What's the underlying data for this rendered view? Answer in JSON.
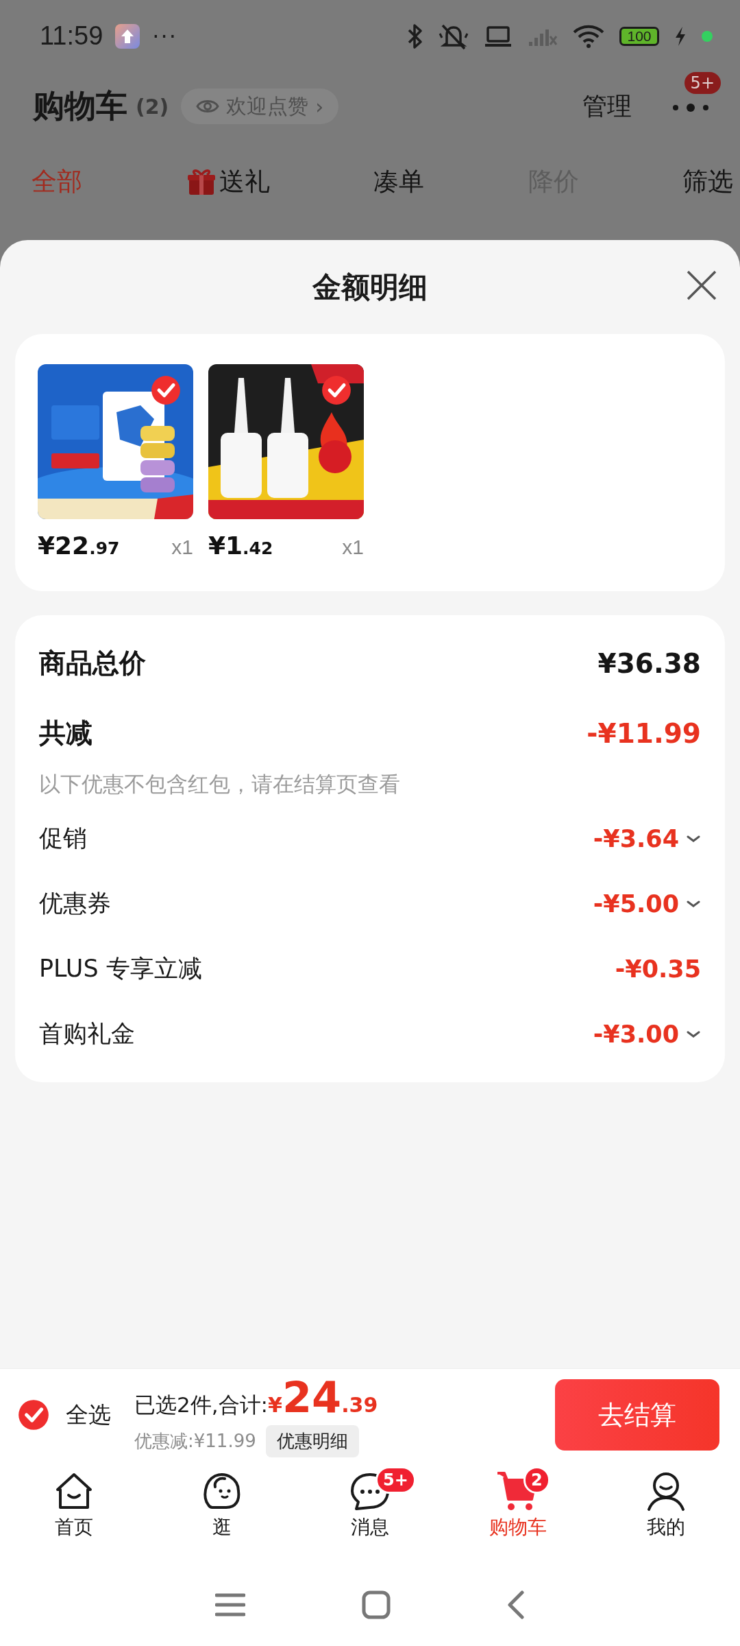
{
  "status_bar": {
    "time": "11:59",
    "more": "···",
    "battery": "100"
  },
  "header": {
    "title": "购物车",
    "count": "(2)",
    "like_pill": "欢迎点赞",
    "like_chevron": "›",
    "manage": "管理",
    "more_badge": "5+"
  },
  "tabs": [
    {
      "label": "全部",
      "selected": true,
      "disabled": false,
      "gift": false
    },
    {
      "label": "送礼",
      "selected": false,
      "disabled": false,
      "gift": true
    },
    {
      "label": "凑单",
      "selected": false,
      "disabled": false,
      "gift": false
    },
    {
      "label": "降价",
      "selected": false,
      "disabled": true,
      "gift": false
    },
    {
      "label": "筛选",
      "selected": false,
      "disabled": false,
      "gift": false
    }
  ],
  "sheet": {
    "title": "金额明细",
    "items": [
      {
        "kind": "picture",
        "selected": true,
        "price": "¥22",
        "price_cents": ".97",
        "quantity": "x1"
      },
      {
        "kind": "picture",
        "selected": true,
        "price": "¥1",
        "price_cents": ".42",
        "quantity": "x1"
      }
    ],
    "summary": {
      "total_label": "商品总价",
      "total_value": "¥36.38",
      "discount_label": "共减",
      "discount_value": "-¥11.99",
      "note": "以下优惠不包含红包，请在结算页查看",
      "rows": [
        {
          "label": "促销",
          "value": "-¥3.64",
          "expandable": true
        },
        {
          "label": "优惠券",
          "value": "-¥5.00",
          "expandable": true
        },
        {
          "label": "PLUS 专享立减",
          "value": "-¥0.35",
          "expandable": false
        },
        {
          "label": "首购礼金",
          "value": "-¥3.00",
          "expandable": true
        }
      ]
    }
  },
  "checkout_bar": {
    "select_all": {
      "label": "全选",
      "checked": true
    },
    "selected_text": "已选2件,合计:",
    "total_currency": "¥",
    "total_integer": "24",
    "total_fraction": ".39",
    "saving": "优惠减:¥11.99",
    "details_button": "优惠明细",
    "checkout_button": "去结算"
  },
  "bottom_nav": [
    {
      "kind": "home",
      "label": "首页",
      "selected": false
    },
    {
      "kind": "browse",
      "label": "逛",
      "selected": false
    },
    {
      "kind": "messages",
      "label": "消息",
      "selected": false,
      "badge": "5+"
    },
    {
      "kind": "cart",
      "label": "购物车",
      "selected": true,
      "badge": "2"
    },
    {
      "kind": "profile",
      "label": "我的",
      "selected": false
    }
  ]
}
